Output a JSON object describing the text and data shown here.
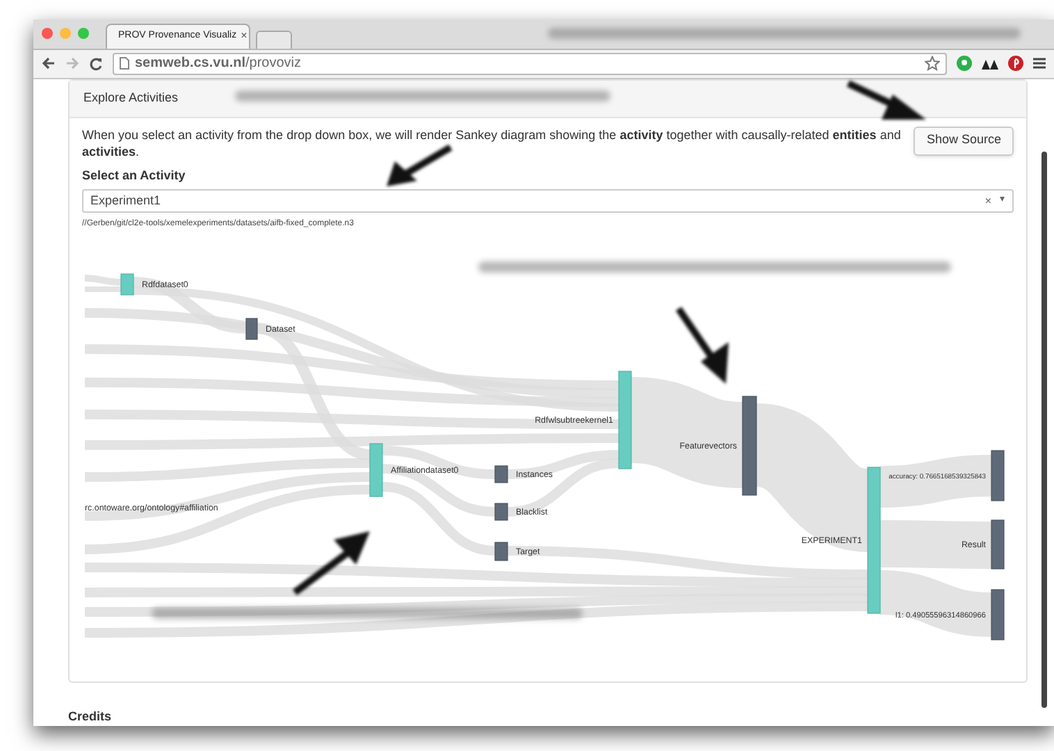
{
  "browser": {
    "tab_title": "PROV Provenance Visualiz",
    "tab_close": "×",
    "url": "**semweb.cs.vu.nl**/provoviz"
  },
  "panel": {
    "title": "Explore Activities",
    "description": "When you select an activity from the drop down box, we will render Sankey diagram showing the **activity** together with causally-related **entities** and **activities**.",
    "button": "Show Source",
    "select_label": "Select an Activity",
    "select_value": "Experiment1",
    "select_clear": "×",
    "select_caret": "▾",
    "file_path": "//Gerben/git/cl2e-tools/xemelexperiments/datasets/aifb-fixed_complete.n3"
  },
  "sankey": {
    "nodes": [
      {
        "label": "Rdfdataset0",
        "kind": "entity"
      },
      {
        "label": "Dataset",
        "kind": "activity"
      },
      {
        "label": "Affiliationdataset0",
        "kind": "entity"
      },
      {
        "label": "Instances",
        "kind": "activity"
      },
      {
        "label": "Blacklist",
        "kind": "activity"
      },
      {
        "label": "Target",
        "kind": "activity"
      },
      {
        "label": "Rdfwlsubtreekernel1",
        "kind": "entity"
      },
      {
        "label": "Featurevectors",
        "kind": "activity"
      },
      {
        "label": "EXPERIMENT1",
        "kind": "entity"
      },
      {
        "label": "accuracy: 0.7665168539325843",
        "kind": "activity"
      },
      {
        "label": "Result",
        "kind": "activity"
      },
      {
        "label": "l1: 0.49055596314860966",
        "kind": "activity"
      },
      {
        "label": "rc.ontoware.org/ontology#affiliation",
        "kind": "external"
      }
    ]
  },
  "footer": {
    "heading": "Credits"
  }
}
